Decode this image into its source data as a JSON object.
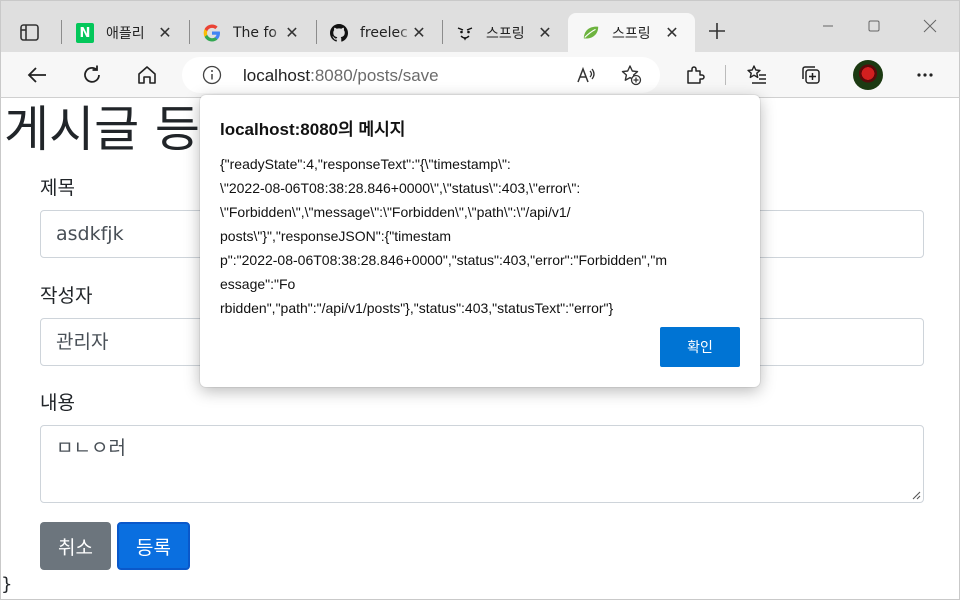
{
  "browser": {
    "tabs": [
      {
        "title": "애플리",
        "icon": "naver-icon",
        "active": false
      },
      {
        "title": "The fo",
        "icon": "google-icon",
        "active": false
      },
      {
        "title": "freelec",
        "icon": "github-icon",
        "active": false
      },
      {
        "title": "스프링",
        "icon": "face-icon",
        "active": false
      },
      {
        "title": "스프링",
        "icon": "spring-leaf-icon",
        "active": true
      }
    ],
    "address": {
      "host": "localhost",
      "rest": ":8080/posts/save"
    }
  },
  "page": {
    "heading": "게시글 등",
    "form": {
      "title_label": "제목",
      "title_value": "asdkfjk",
      "author_label": "작성자",
      "author_value": "관리자",
      "content_label": "내용",
      "content_value": "ㅁㄴㅇ러"
    },
    "buttons": {
      "cancel": "취소",
      "submit": "등록"
    },
    "trailing_text": "}"
  },
  "dialog": {
    "title": "localhost:8080의 메시지",
    "message_lines": [
      "{\"readyState\":4,\"responseText\":\"{\\\"timestamp\\\":",
      "\\\"2022-08-06T08:38:28.846+0000\\\",\\\"status\\\":403,\\\"error\\\":",
      "\\\"Forbidden\\\",\\\"message\\\":\\\"Forbidden\\\",\\\"path\\\":\\\"/api/v1/",
      "posts\\\"}\",\"responseJSON\":{\"timestam",
      "p\":\"2022-08-06T08:38:28.846+0000\",\"status\":403,\"error\":\"Forbidden\",\"m",
      "essage\":\"Fo",
      "rbidden\",\"path\":\"/api/v1/posts\"},\"status\":403,\"statusText\":\"error\"}"
    ],
    "ok_label": "확인"
  },
  "colors": {
    "primary": "#0a6fe0",
    "secondary": "#6c757d",
    "dialog_ok": "#0074d4",
    "naver_green": "#03c75a",
    "spring_green": "#6db33f"
  }
}
